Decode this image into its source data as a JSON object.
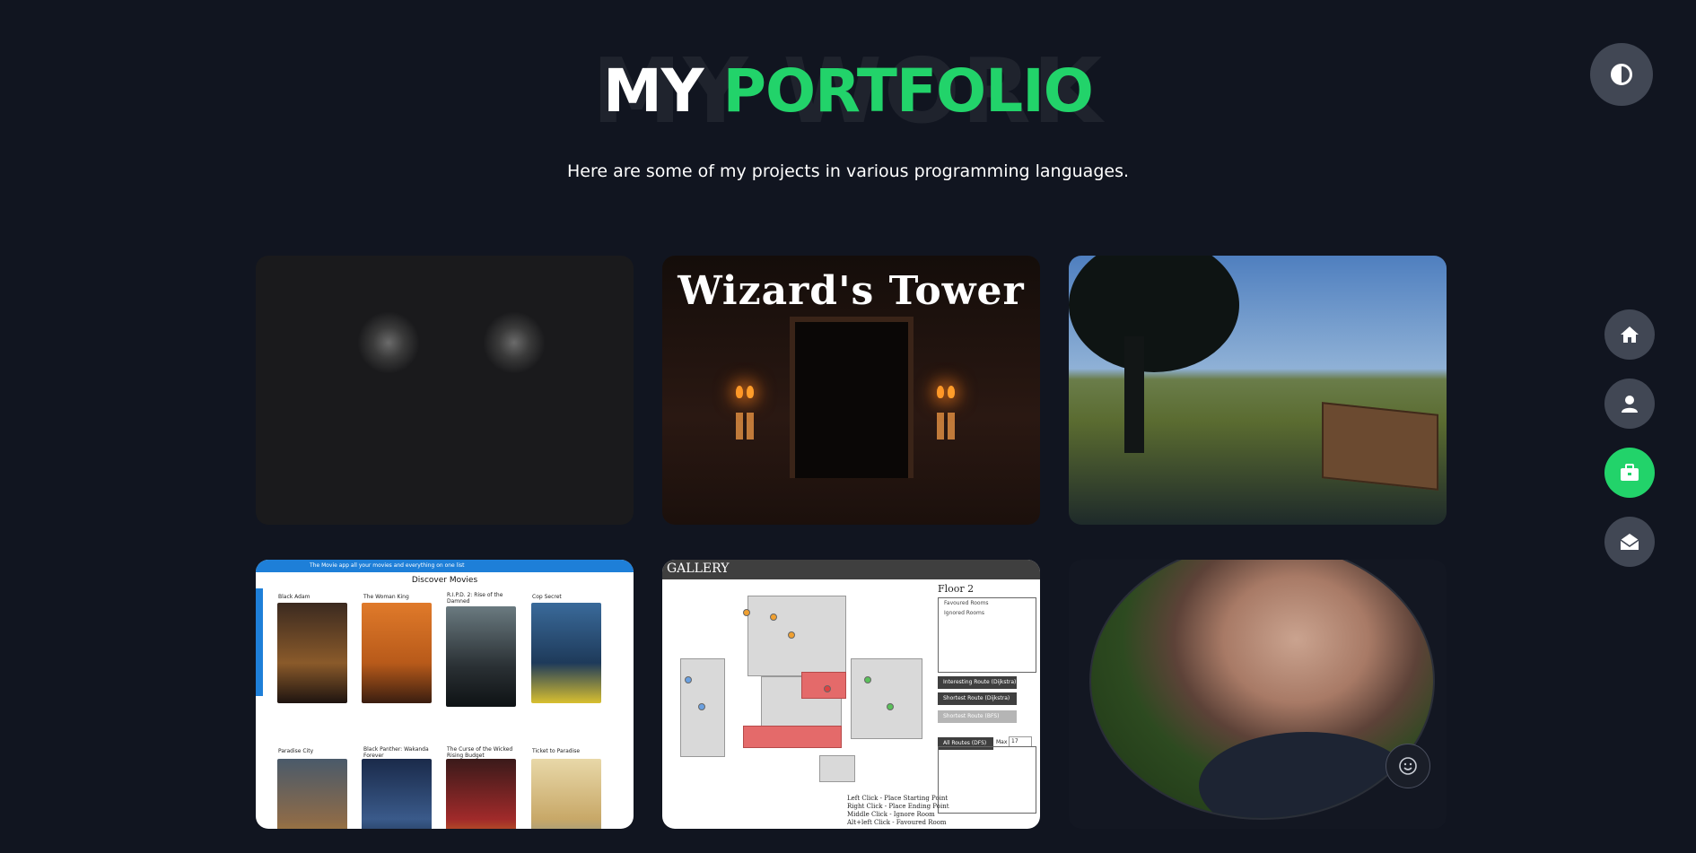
{
  "header": {
    "background_word": "MY WORK",
    "title_part1": "MY",
    "title_part2": "PORTFOLIO",
    "subtitle": "Here are some of my projects in various programming languages."
  },
  "colors": {
    "accent": "#22d36a",
    "background": "#111520",
    "button": "#414754"
  },
  "theme_toggle": {
    "icon": "contrast-icon"
  },
  "side_nav": {
    "items": [
      {
        "icon": "home-icon",
        "active": false
      },
      {
        "icon": "user-icon",
        "active": false
      },
      {
        "icon": "briefcase-icon",
        "active": true
      },
      {
        "icon": "mail-icon",
        "active": false
      }
    ]
  },
  "projects": [
    {
      "name": "horror-game"
    },
    {
      "name": "wizards-tower",
      "title": "Wizard's Tower"
    },
    {
      "name": "landscape-game"
    },
    {
      "name": "movie-app",
      "banner": "The Movie app all your movies and everything on one list",
      "title": "Discover Movies",
      "movies": [
        "Black Adam",
        "The Woman King",
        "R.I.P.D. 2: Rise of the Damned",
        "Cop Secret"
      ],
      "movies_row2": [
        "Paradise City",
        "Black Panther: Wakanda Forever",
        "The Curse of the Wicked Rising Budget",
        "Ticket to Paradise"
      ]
    },
    {
      "name": "gallery-map",
      "header": "GALLERY",
      "floor": "Floor 2",
      "list_items": [
        "Favoured Rooms",
        "Ignored Rooms"
      ],
      "buttons": [
        "Interesting Route (Dijkstra)",
        "Shortest Route (Dijkstra)",
        "Shortest Route (BFS)",
        "All Routes (DFS)"
      ],
      "max_label": "Max",
      "max_value": "17",
      "legend": [
        "Left Click - Place Starting Point",
        "Right Click - Place Ending Point",
        "Middle Click - Ignore Room",
        "Alt+left Click - Favoured Room"
      ]
    },
    {
      "name": "portrait",
      "icon": "smile-icon"
    }
  ]
}
